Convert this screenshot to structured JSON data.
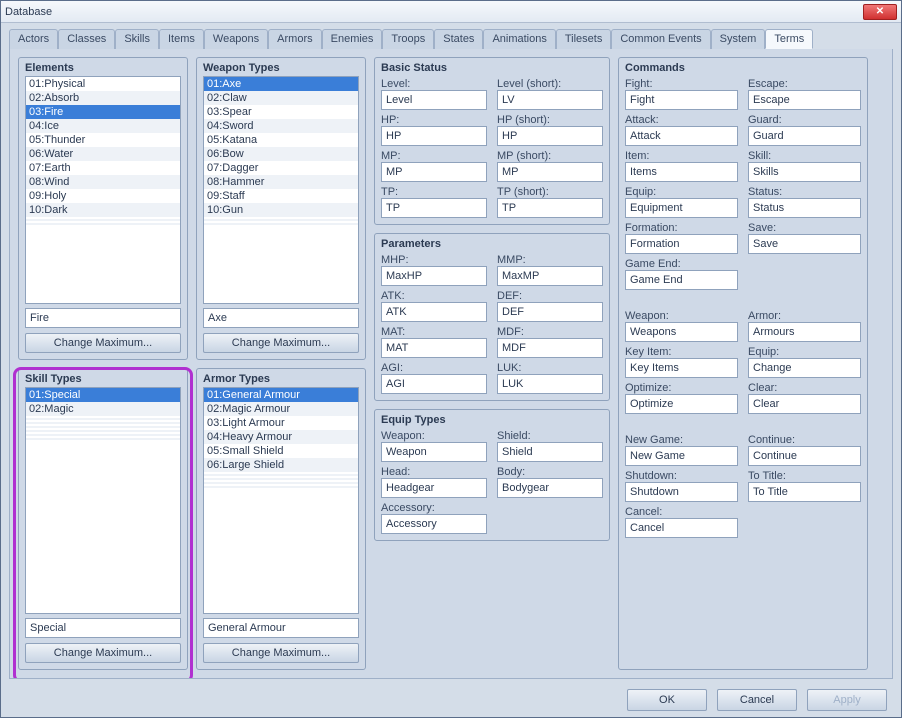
{
  "window": {
    "title": "Database"
  },
  "tabs": [
    "Actors",
    "Classes",
    "Skills",
    "Items",
    "Weapons",
    "Armors",
    "Enemies",
    "Troops",
    "States",
    "Animations",
    "Tilesets",
    "Common Events",
    "System",
    "Terms"
  ],
  "active_tab": "Terms",
  "elements": {
    "title": "Elements",
    "items": [
      "01:Physical",
      "02:Absorb",
      "03:Fire",
      "04:Ice",
      "05:Thunder",
      "06:Water",
      "07:Earth",
      "08:Wind",
      "09:Holy",
      "10:Dark"
    ],
    "selected": 2,
    "value": "Fire",
    "btn": "Change Maximum..."
  },
  "weapon_types": {
    "title": "Weapon Types",
    "items": [
      "01:Axe",
      "02:Claw",
      "03:Spear",
      "04:Sword",
      "05:Katana",
      "06:Bow",
      "07:Dagger",
      "08:Hammer",
      "09:Staff",
      "10:Gun"
    ],
    "selected": 0,
    "value": "Axe",
    "btn": "Change Maximum..."
  },
  "skill_types": {
    "title": "Skill Types",
    "items": [
      "01:Special",
      "02:Magic"
    ],
    "selected": 0,
    "value": "Special",
    "btn": "Change Maximum..."
  },
  "armor_types": {
    "title": "Armor Types",
    "items": [
      "01:General Armour",
      "02:Magic Armour",
      "03:Light Armour",
      "04:Heavy Armour",
      "05:Small Shield",
      "06:Large Shield"
    ],
    "selected": 0,
    "value": "General Armour",
    "btn": "Change Maximum..."
  },
  "basic_status": {
    "title": "Basic Status",
    "fields": [
      {
        "l": "Level:",
        "v": "Level"
      },
      {
        "l": "Level (short):",
        "v": "LV"
      },
      {
        "l": "HP:",
        "v": "HP"
      },
      {
        "l": "HP (short):",
        "v": "HP"
      },
      {
        "l": "MP:",
        "v": "MP"
      },
      {
        "l": "MP (short):",
        "v": "MP"
      },
      {
        "l": "TP:",
        "v": "TP"
      },
      {
        "l": "TP (short):",
        "v": "TP"
      }
    ]
  },
  "parameters": {
    "title": "Parameters",
    "fields": [
      {
        "l": "MHP:",
        "v": "MaxHP"
      },
      {
        "l": "MMP:",
        "v": "MaxMP"
      },
      {
        "l": "ATK:",
        "v": "ATK"
      },
      {
        "l": "DEF:",
        "v": "DEF"
      },
      {
        "l": "MAT:",
        "v": "MAT"
      },
      {
        "l": "MDF:",
        "v": "MDF"
      },
      {
        "l": "AGI:",
        "v": "AGI"
      },
      {
        "l": "LUK:",
        "v": "LUK"
      }
    ]
  },
  "equip_types": {
    "title": "Equip Types",
    "fields": [
      {
        "l": "Weapon:",
        "v": "Weapon"
      },
      {
        "l": "Shield:",
        "v": "Shield"
      },
      {
        "l": "Head:",
        "v": "Headgear"
      },
      {
        "l": "Body:",
        "v": "Bodygear"
      },
      {
        "l": "Accessory:",
        "v": "Accessory"
      }
    ]
  },
  "commands": {
    "title": "Commands",
    "fields": [
      {
        "l": "Fight:",
        "v": "Fight"
      },
      {
        "l": "Escape:",
        "v": "Escape"
      },
      {
        "l": "Attack:",
        "v": "Attack"
      },
      {
        "l": "Guard:",
        "v": "Guard"
      },
      {
        "l": "Item:",
        "v": "Items"
      },
      {
        "l": "Skill:",
        "v": "Skills"
      },
      {
        "l": "Equip:",
        "v": "Equipment"
      },
      {
        "l": "Status:",
        "v": "Status"
      },
      {
        "l": "Formation:",
        "v": "Formation"
      },
      {
        "l": "Save:",
        "v": "Save"
      },
      {
        "l": "Game End:",
        "v": "Game End"
      },
      {
        "l": "",
        "v": ""
      },
      {
        "l": "",
        "v": ""
      },
      {
        "l": "",
        "v": ""
      },
      {
        "l": "Weapon:",
        "v": "Weapons"
      },
      {
        "l": "Armor:",
        "v": "Armours"
      },
      {
        "l": "Key Item:",
        "v": "Key Items"
      },
      {
        "l": "Equip:",
        "v": "Change"
      },
      {
        "l": "Optimize:",
        "v": "Optimize"
      },
      {
        "l": "Clear:",
        "v": "Clear"
      },
      {
        "l": "",
        "v": ""
      },
      {
        "l": "",
        "v": ""
      },
      {
        "l": "New Game:",
        "v": "New Game"
      },
      {
        "l": "Continue:",
        "v": "Continue"
      },
      {
        "l": "Shutdown:",
        "v": "Shutdown"
      },
      {
        "l": "To Title:",
        "v": "To Title"
      },
      {
        "l": "Cancel:",
        "v": "Cancel"
      }
    ]
  },
  "buttons": {
    "ok": "OK",
    "cancel": "Cancel",
    "apply": "Apply"
  }
}
